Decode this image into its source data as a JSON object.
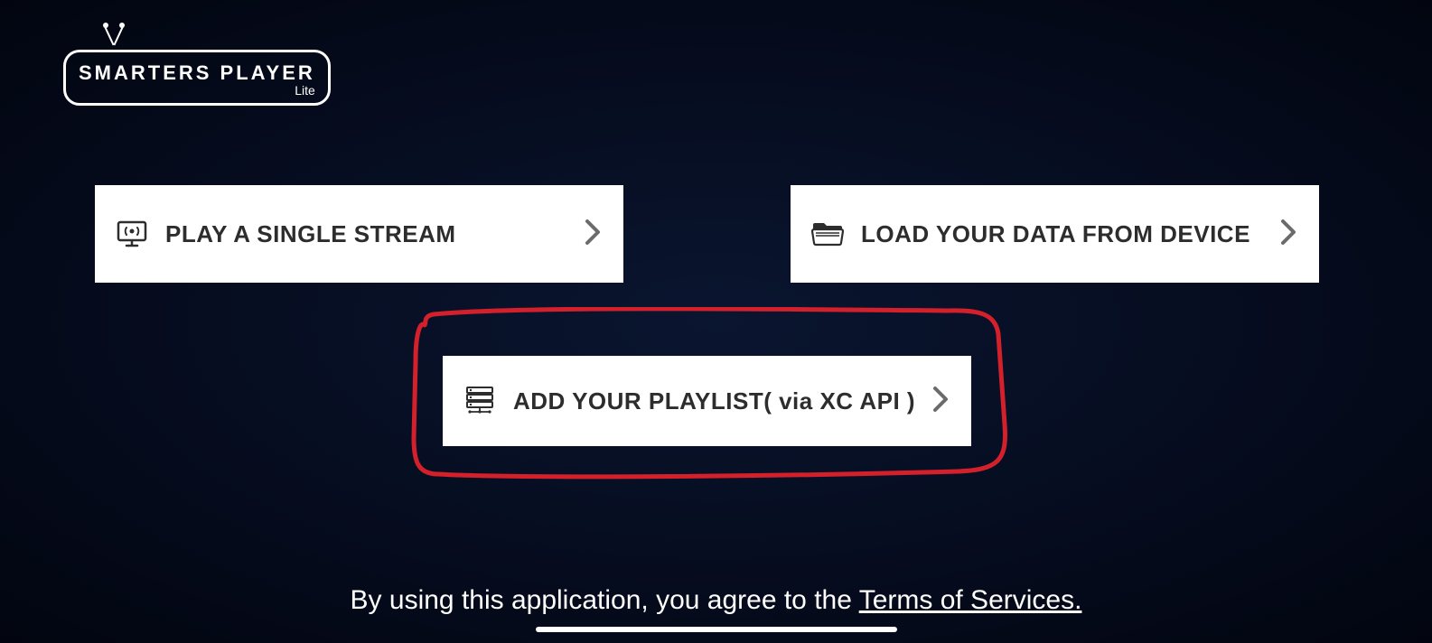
{
  "logo": {
    "title": "SMARTERS PLAYER",
    "sub": "Lite"
  },
  "options": {
    "play_single": "PLAY A SINGLE STREAM",
    "load_device": "LOAD YOUR DATA FROM DEVICE",
    "add_playlist": "ADD YOUR PLAYLIST( via XC API )"
  },
  "footer": {
    "prefix": "By using this application, you agree to the ",
    "link": "Terms of Services."
  }
}
